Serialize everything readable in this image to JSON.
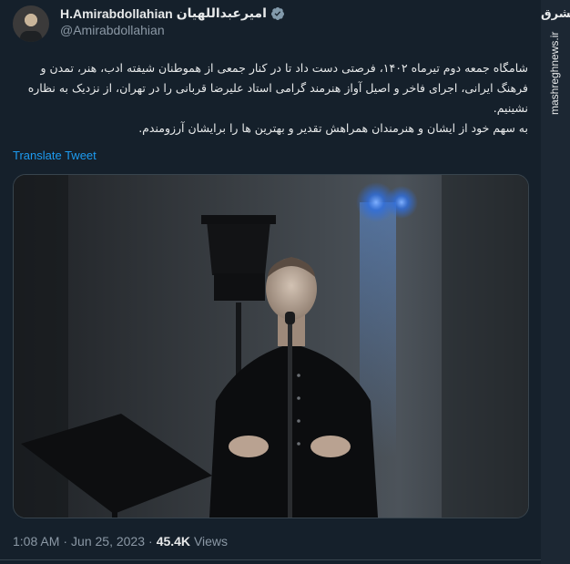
{
  "tweet": {
    "display_name": "H.Amirabdollahian",
    "display_name_fa": "امیرعبداللهیان",
    "handle": "@Amirabdollahian",
    "text_paragraph_1": "شامگاه جمعه دوم تیرماه ۱۴۰۲، فرصتی دست داد تا در کنار جمعی از هموطنان شیفته ادب، هنر، تمدن و فرهنگ ایرانی، اجرای فاخر و اصیل آواز هنرمند گرامی استاد علیرضا قربانی را در تهران، از نزدیک به نظاره نشینیم.",
    "text_paragraph_2": "به سهم خود از ایشان و هنرمندان همراهش تقدیر و بهترین ها را برایشان آرزومندم.",
    "translate_label": "Translate Tweet",
    "time": "1:08 AM",
    "date": "Jun 25, 2023",
    "views_count": "45.4K",
    "views_label": "Views"
  },
  "watermark": {
    "logo_text": "مشرق",
    "site": "mashreghnews.ir"
  },
  "colors": {
    "background": "#15202b",
    "link": "#1d9bf0",
    "verified": "#829aab",
    "muted": "#8b98a5"
  },
  "icons": {
    "verified": "verified-badge-icon"
  }
}
